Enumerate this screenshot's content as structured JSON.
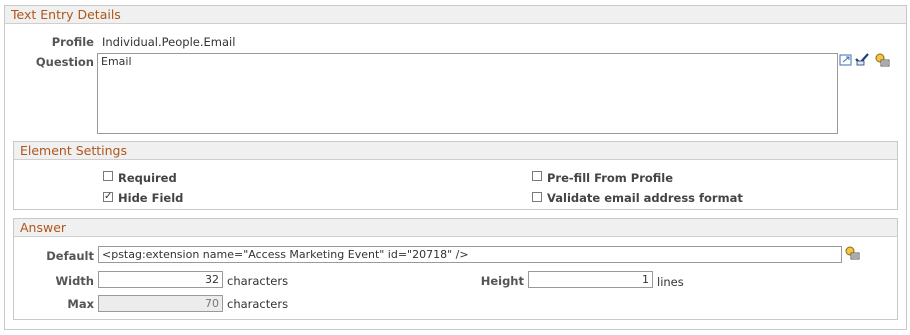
{
  "text_entry": {
    "title": "Text Entry Details",
    "profile_label": "Profile",
    "profile_value": "Individual.People.Email",
    "question_label": "Question",
    "question_value": "Email",
    "icons": [
      "expand-text-icon",
      "spell-check-icon",
      "lookup-icon"
    ]
  },
  "element_settings": {
    "title": "Element Settings",
    "required": {
      "label": "Required",
      "checked": false
    },
    "hide_field": {
      "label": "Hide Field",
      "checked": true
    },
    "prefill": {
      "label": "Pre-fill From Profile",
      "checked": false
    },
    "validate_email": {
      "label": "Validate email address format",
      "checked": false
    }
  },
  "answer": {
    "title": "Answer",
    "default_label": "Default",
    "default_value": "<pstag:extension name=\"Access Marketing Event\" id=\"20718\" />",
    "width_label": "Width",
    "width_value": "32",
    "width_unit": "characters",
    "height_label": "Height",
    "height_value": "1",
    "height_unit": "lines",
    "max_label": "Max",
    "max_value": "70",
    "max_unit": "characters"
  },
  "colors": {
    "section_title": "#b0551a",
    "header_bg": "#f0f0f0",
    "border": "#c9c9c9"
  }
}
